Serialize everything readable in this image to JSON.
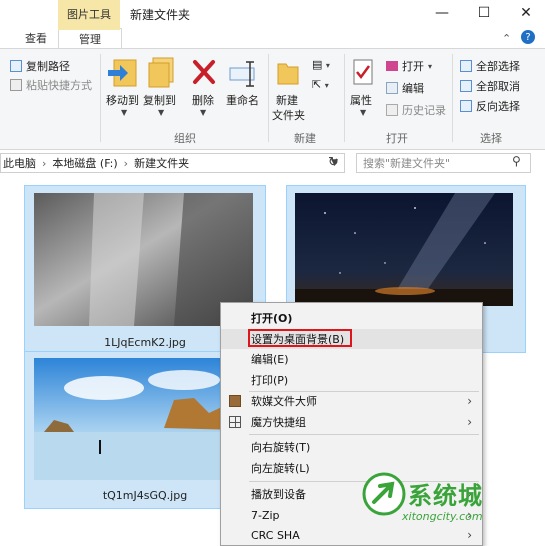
{
  "titlebar": {
    "context_tab": "图片工具",
    "title": "新建文件夹",
    "minimize": "—",
    "maximize": "☐",
    "close": "✕"
  },
  "tabs": {
    "view": "查看",
    "manage": "管理",
    "help_icon": "?"
  },
  "ribbon": {
    "clipboard": {
      "copy_path": "复制路径",
      "paste_shortcut": "粘贴快捷方式"
    },
    "organize": {
      "move_to": "移动到",
      "copy_to": "复制到",
      "delete": "删除",
      "rename": "重命名",
      "label": "组织"
    },
    "new": {
      "new_folder_line1": "新建",
      "new_folder_line2": "文件夹",
      "label": "新建"
    },
    "open": {
      "properties": "属性",
      "open": "打开",
      "edit": "编辑",
      "history": "历史记录",
      "label": "打开"
    },
    "select": {
      "select_all": "全部选择",
      "select_none": "全部取消",
      "invert": "反向选择",
      "label": "选择"
    }
  },
  "address": {
    "crumbs": [
      "此电脑",
      "本地磁盘 (F:)",
      "新建文件夹"
    ],
    "search_placeholder": "搜索\"新建文件夹\""
  },
  "files": [
    {
      "name": "1LJqEcmK2.jpg"
    },
    {
      "name": ""
    },
    {
      "name": "tQ1mJ4sGQ.jpg"
    }
  ],
  "context_menu": {
    "items": [
      {
        "label": "打开(O)",
        "bold": true
      },
      {
        "label": "设置为桌面背景(B)",
        "highlighted": true
      },
      {
        "label": "编辑(E)"
      },
      {
        "label": "打印(P)"
      },
      {
        "label": "软媒文件大师",
        "submenu": true
      },
      {
        "label": "魔方快捷组",
        "submenu": true
      },
      {
        "label": "向右旋转(T)"
      },
      {
        "label": "向左旋转(L)"
      },
      {
        "label": "播放到设备",
        "submenu": true
      },
      {
        "label": "7-Zip",
        "submenu": true
      },
      {
        "label": "CRC SHA",
        "submenu": true
      }
    ]
  },
  "watermark": {
    "brand": "系统城",
    "url": "xitongcity.com"
  },
  "colors": {
    "context_tab": "#f6e7a9",
    "selection_bg": "#cde5f7",
    "selection_border": "#99d1ff",
    "menu_highlight_border": "#e0141b",
    "delete_red": "#c8202b",
    "watermark_green": "#3aa43a"
  }
}
